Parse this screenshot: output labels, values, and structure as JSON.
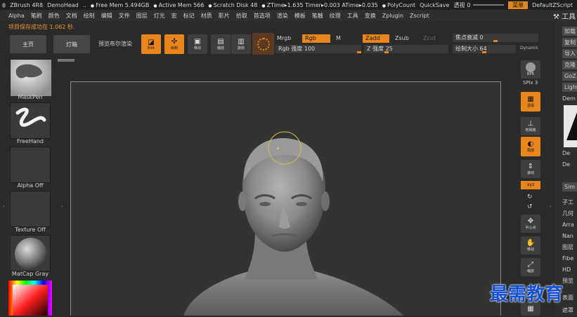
{
  "titlebar": {
    "app": "ZBrush 4R8",
    "project": "DemoHead",
    "ellipsis": "..",
    "free_mem": "Free Mem 5.494GB",
    "active_mem": "Active Mem 566",
    "scratch_disk": "Scratch Disk 48",
    "timings": "ZTime▸1.635 Timer▸0.003 ATime▸0.035",
    "polycount": "PolyCount",
    "quicksave": "QuickSave",
    "opacity_label": "透视",
    "opacity_value": "0",
    "menu_button": "菜单",
    "script": "DefaultZScript"
  },
  "menubar": [
    "Alpha",
    "笔刷",
    "颜色",
    "文档",
    "绘制",
    "编辑",
    "文件",
    "图层",
    "灯光",
    "宏",
    "标记",
    "材质",
    "影片",
    "拾取",
    "首选项",
    "渲染",
    "模板",
    "笔触",
    "纹理",
    "工具",
    "变换",
    "Zplugin",
    "Zscript"
  ],
  "right_title": "工具",
  "status": "项目保存成功在 1.062 秒.",
  "shelf": {
    "home": "主页",
    "lightbox": "灯箱",
    "preview_render": "预览布尔渲染",
    "edit": "Edit",
    "draw": "绘制",
    "move": "移动",
    "scale": "缩放",
    "rotate": "旋转"
  },
  "draw_settings": {
    "mrgb": "Mrgb",
    "rgb": "Rgb",
    "m": "M",
    "zadd": "Zadd",
    "zsub": "Zsub",
    "zcut": "Zcut",
    "rgb_intensity": "Rgb 强度 100",
    "rgb_intensity_value": 100,
    "z_intensity": "Z 强度 25",
    "z_intensity_value": 25,
    "focal_shift": "焦点衰减 0",
    "focal_shift_value": 0,
    "draw_size": "绘制大小 64",
    "draw_size_value": 64,
    "dynamic": "Dynamic"
  },
  "left_panel": {
    "brush": "MaskPen",
    "stroke": "FreeHand",
    "alpha": "Alpha Off",
    "texture": "Texture Off",
    "material": "MatCap Gray"
  },
  "right_tools": {
    "bpr": "BPR",
    "spix": "SPix 3",
    "dynamic_persp": "透视",
    "floor": "地网格",
    "local": "局部",
    "scroll": "滚动",
    "xyz": "xyz",
    "center": "中心点",
    "move": "移动",
    "scale": "缩放"
  },
  "right_panel": [
    "加载",
    "复制",
    "导入",
    "克隆",
    "GoZ",
    "Light",
    "Dem",
    "De",
    "De",
    "Sim",
    "子工",
    "几何",
    "Arra",
    "Nan",
    "图层",
    "Fibe",
    "HD",
    "预览",
    "表面",
    "遮罩"
  ],
  "watermark": "最需教育",
  "colors": {
    "accent": "#e8861c",
    "background": "#2b2b2b",
    "watermark": "#1450d0"
  }
}
